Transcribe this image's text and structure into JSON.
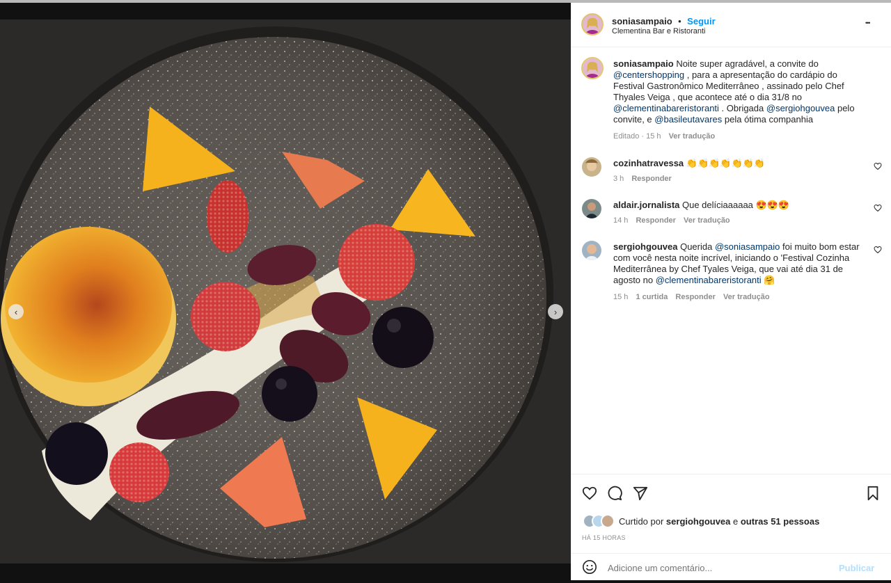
{
  "post": {
    "author": "soniasampaio",
    "follow_label": "Seguir",
    "separator": "•",
    "location": "Clementina Bar e Ristoranti",
    "more_label": "•••"
  },
  "caption": {
    "author": "soniasampaio",
    "text_1": " Noite super agradável, a convite do ",
    "mention_1": "@centershopping",
    "text_2": " , para a apresentação do cardápio do Festival Gastronômico Mediterrâneo , assinado pelo Chef Thyales Veiga , que acontece até o dia 31/8 no ",
    "mention_2": "@clementinabareristoranti",
    "text_3": " . Obrigada ",
    "mention_3": "@sergiohgouvea",
    "text_4": " pelo convite, e ",
    "mention_4": "@basileutavares",
    "text_5": " pela ótima companhia",
    "edited": "Editado · 15 h",
    "translate": "Ver tradução"
  },
  "comments": [
    {
      "author": "cozinhatravessa",
      "text": " 👏👏👏👏👏👏👏",
      "time": "3 h",
      "reply": "Responder"
    },
    {
      "author": "aldair.jornalista",
      "text": " Que delíciaaaaaa 😍😍😍",
      "time": "14 h",
      "reply": "Responder",
      "translate": "Ver tradução"
    },
    {
      "author": "sergiohgouvea",
      "text_1": " Querida ",
      "mention": "@soniasampaio",
      "text_2": " foi muito bom estar com você nesta noite incrível, iniciando o 'Festival Cozinha Mediterrânea by Chef Tyales Veiga, que vai até dia 31 de agosto no ",
      "mention_2": "@clementinabareristoranti",
      "text_3": " 🤗",
      "time": "15 h",
      "likes": "1 curtida",
      "reply": "Responder",
      "translate": "Ver tradução"
    }
  ],
  "likes": {
    "prefix": "Curtido por ",
    "user": "sergiohgouvea",
    "middle": " e ",
    "others": "outras 51 pessoas",
    "timestamp": "HÁ 15 HORAS"
  },
  "comment_input": {
    "placeholder": "Adicione um comentário...",
    "publish_label": "Publicar"
  },
  "carousel": {
    "prev": "‹",
    "next": "›",
    "slide_count": 1
  },
  "colors": {
    "link": "#0095f6",
    "mention": "#00376b",
    "muted": "#8e8e8e",
    "publish_disabled": "#b2dffc"
  }
}
